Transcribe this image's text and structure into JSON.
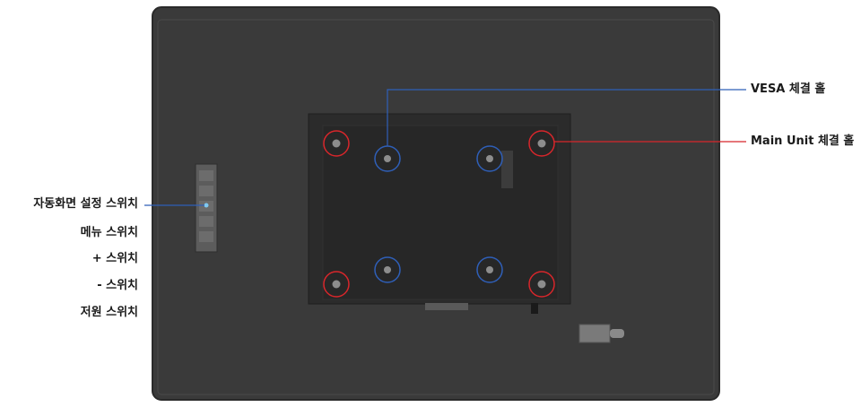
{
  "labels": {
    "vesa_hole": "VESA 체결 홀",
    "main_unit_hole": "Main Unit 체결 홀",
    "auto_screen_switch": "자동화면 설정 스위치",
    "menu_switch": "메뉴 스위치",
    "plus_switch": "+ 스위치",
    "minus_switch": "- 스위치",
    "power_switch": "저원 스위치"
  },
  "colors": {
    "panel": "#3a3a3a",
    "mount_plate": "#2b2b2b",
    "vesa_circle": "#2f5fb8",
    "main_unit_circle": "#d8262b",
    "leader_blue": "#2f5fb8",
    "leader_red": "#d8262b"
  }
}
